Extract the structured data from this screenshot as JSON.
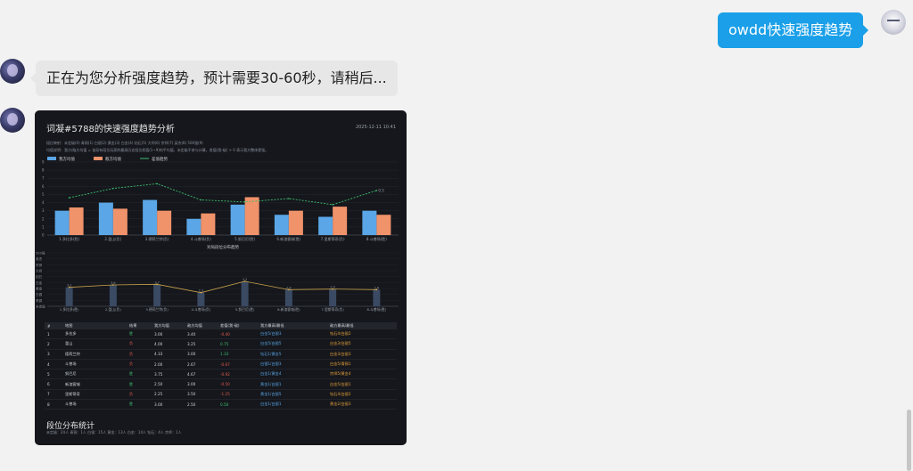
{
  "chat": {
    "user_message": "owdd快速强度趋势",
    "bot_message": "正在为您分析强度趋势，预计需要30-60秒，请稍后..."
  },
  "card": {
    "title": "词凝#5788的快速强度趋势分析",
    "timestamp": "2025-12-11 10:41",
    "meta_rank_mapping": "段位映射：未定级(0) 青铜(1) 白银(2) 黄金(3) 白金(4) 钻石(5) 大师(6) 宗师(7) 英杰(8) 500强(9)",
    "meta_desc": "均值说明：我方/敌方均值 = 该局有段位玩家的最高历史段位权值(1~9)的平均值，未定级不参与计算。差值(我-敌) > 0 表示我方整体更强。"
  },
  "colors": {
    "our_bar": "#5aa6e6",
    "enemy_bar": "#f0926a",
    "diff_line": "#3fbf6f",
    "avg_line": "#c9a24a",
    "card_bg": "#15171c",
    "user_bubble": "#1a9fe8"
  },
  "chart_data": [
    {
      "type": "bar",
      "legend": [
        "我方均值",
        "敌方均值",
        "差值趋势"
      ],
      "categories": [
        "1.多拉多(胜)",
        "2.釜山(负)",
        "3.德莉兰特(负)",
        "4.斗兽场(负)",
        "5.努巴尼(胜)",
        "6.新渣客城(胜)",
        "7.里斯蒂奇(负)",
        "8.斗兽场(胜)"
      ],
      "series": [
        {
          "name": "我方均值",
          "values": [
            3.0,
            4.0,
            4.33,
            2.0,
            3.75,
            2.5,
            2.25,
            3.0
          ]
        },
        {
          "name": "敌方均值",
          "values": [
            3.4,
            3.25,
            3.0,
            2.67,
            4.67,
            3.0,
            3.5,
            2.5
          ]
        },
        {
          "name": "差值趋势",
          "values": [
            -0.4,
            0.75,
            1.33,
            -0.67,
            -0.92,
            -0.5,
            -1.25,
            0.5
          ]
        }
      ],
      "ylim": [
        0,
        9
      ],
      "yticks": [
        "0",
        "1",
        "2",
        "3",
        "4",
        "5",
        "6",
        "7",
        "8",
        "9"
      ],
      "end_label": "0.5"
    },
    {
      "type": "line",
      "title": "对局段位分布趋势",
      "categories": [
        "1.多拉多(胜)",
        "2.釜山(负)",
        "3.德莉兰特(负)",
        "4.斗兽场(负)",
        "5.努巴尼(胜)",
        "6.新渣客城(胜)",
        "7.里斯蒂奇(负)",
        "8.斗兽场(胜)"
      ],
      "values": [
        3.2,
        3.6,
        3.7,
        2.3,
        4.2,
        2.8,
        2.9,
        2.8
      ],
      "value_labels": [
        "3.2",
        "3.6",
        "3.7",
        "2.3",
        "4.2",
        "2.8",
        "2.9",
        "2.8"
      ],
      "yticks": [
        "500强",
        "英杰",
        "宗师",
        "大师",
        "钻石",
        "白金",
        "黄金",
        "白银",
        "青铜",
        "未定级"
      ],
      "ylim": [
        0,
        9
      ]
    }
  ],
  "table": {
    "headers": [
      "#",
      "地图",
      "结果",
      "我方均值",
      "敌方均值",
      "差值(我-敌)",
      "我方最高/最低",
      "敌方最高/最低"
    ],
    "rows": [
      {
        "n": "1",
        "map": "多拉多",
        "result": "胜",
        "our": "3.00",
        "enemy": "3.40",
        "diff": "-0.40",
        "our_range": "白金5/白银3",
        "enemy_range": "钻石4/白银2"
      },
      {
        "n": "2",
        "map": "釜山",
        "result": "负",
        "our": "4.00",
        "enemy": "3.25",
        "diff": "0.75",
        "our_range": "白金5/白银5",
        "enemy_range": "白金3/白银5"
      },
      {
        "n": "3",
        "map": "德莉兰特",
        "result": "负",
        "our": "4.33",
        "enemy": "3.00",
        "diff": "1.33",
        "our_range": "钻石1/黄金5",
        "enemy_range": "白金3/白银3"
      },
      {
        "n": "4",
        "map": "斗兽场",
        "result": "负",
        "our": "2.00",
        "enemy": "2.67",
        "diff": "-0.67",
        "our_range": "白银1/白银3",
        "enemy_range": "白金5/青铜1"
      },
      {
        "n": "5",
        "map": "努巴尼",
        "result": "胜",
        "our": "3.75",
        "enemy": "4.67",
        "diff": "-0.92",
        "our_range": "白金1/黄金4",
        "enemy_range": "宗师5/黄金4"
      },
      {
        "n": "6",
        "map": "新渣客城",
        "result": "胜",
        "our": "2.50",
        "enemy": "3.00",
        "diff": "-0.50",
        "our_range": "黄金1/白银1",
        "enemy_range": "白金5/白银1"
      },
      {
        "n": "7",
        "map": "里斯蒂奇",
        "result": "负",
        "our": "2.25",
        "enemy": "3.50",
        "diff": "-1.25",
        "our_range": "黄金1/白银5",
        "enemy_range": "钻石4/白银2"
      },
      {
        "n": "8",
        "map": "斗兽场",
        "result": "胜",
        "our": "3.00",
        "enemy": "2.50",
        "diff": "0.50",
        "our_range": "白金1/白银1",
        "enemy_range": "黄金2/白银3"
      }
    ]
  },
  "stats": {
    "title": "段位分布统计",
    "line": "未定级：24人    青铜：1人    白银：15人    黄金：13人    白金：14人    钻石：4人    宗师：1人"
  }
}
